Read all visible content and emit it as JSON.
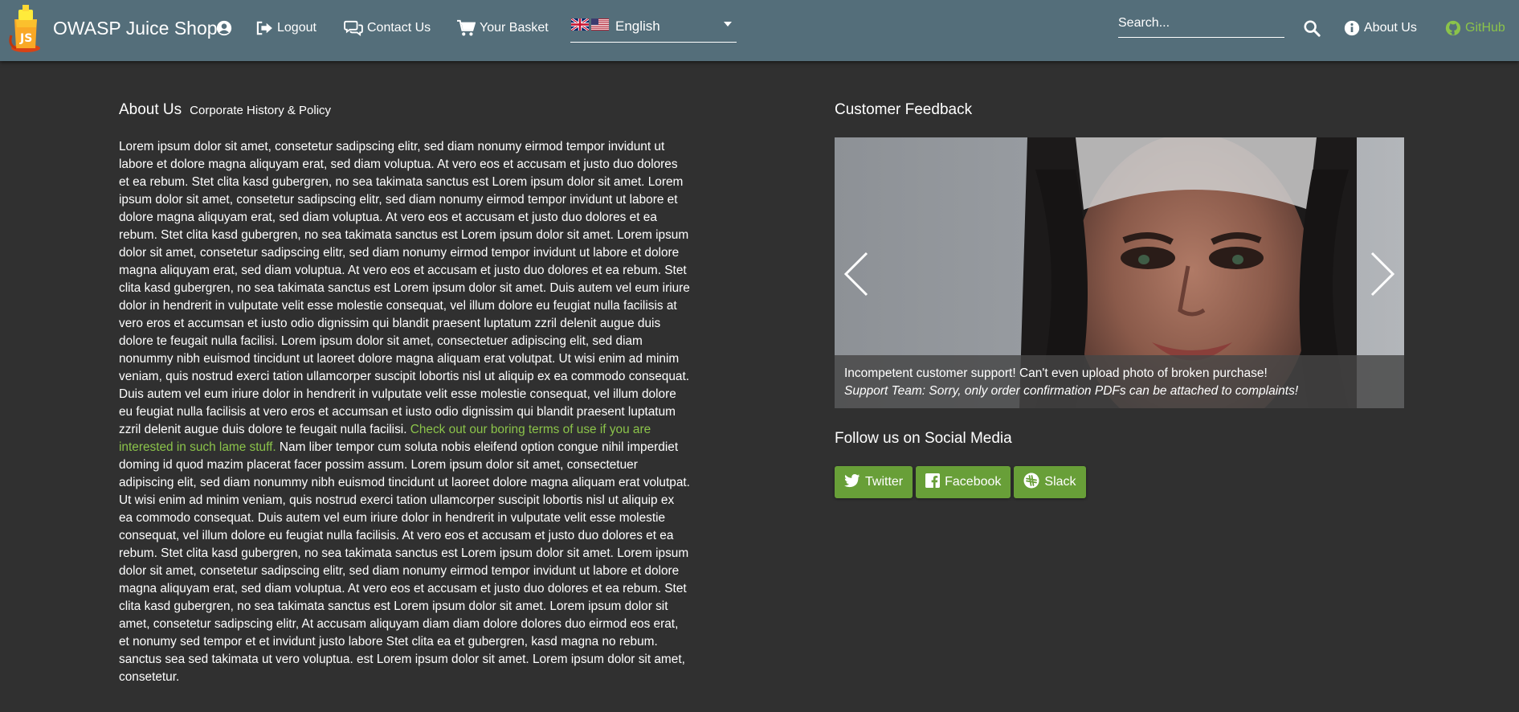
{
  "colors": {
    "navbar": "#546e7a",
    "background": "#303030",
    "accent_green": "#8bc34a",
    "button_green": "#689f38"
  },
  "navbar": {
    "brand": {
      "title": "OWASP Juice Shop",
      "icon": "juice-shop-logo"
    },
    "account": {
      "icon": "account-circle-icon"
    },
    "logout": {
      "label": "Logout",
      "icon": "sign-out-icon"
    },
    "contact": {
      "label": "Contact Us",
      "icon": "comments-icon"
    },
    "basket": {
      "label": "Your Basket",
      "icon": "cart-icon"
    },
    "language": {
      "selected": "English",
      "icons": [
        "uk-flag-icon",
        "us-flag-icon"
      ]
    },
    "search": {
      "placeholder": "Search..."
    },
    "about": {
      "label": "About Us",
      "icon": "info-circle-icon"
    },
    "github": {
      "label": "GitHub",
      "icon": "github-icon"
    }
  },
  "about": {
    "title": "About Us",
    "subtitle": "Corporate History & Policy",
    "text_before_link": "Lorem ipsum dolor sit amet, consetetur sadipscing elitr, sed diam nonumy eirmod tempor invidunt ut labore et dolore magna aliquyam erat, sed diam voluptua. At vero eos et accusam et justo duo dolores et ea rebum. Stet clita kasd gubergren, no sea takimata sanctus est Lorem ipsum dolor sit amet. Lorem ipsum dolor sit amet, consetetur sadipscing elitr, sed diam nonumy eirmod tempor invidunt ut labore et dolore magna aliquyam erat, sed diam voluptua. At vero eos et accusam et justo duo dolores et ea rebum. Stet clita kasd gubergren, no sea takimata sanctus est Lorem ipsum dolor sit amet. Lorem ipsum dolor sit amet, consetetur sadipscing elitr, sed diam nonumy eirmod tempor invidunt ut labore et dolore magna aliquyam erat, sed diam voluptua. At vero eos et accusam et justo duo dolores et ea rebum. Stet clita kasd gubergren, no sea takimata sanctus est Lorem ipsum dolor sit amet. Duis autem vel eum iriure dolor in hendrerit in vulputate velit esse molestie consequat, vel illum dolore eu feugiat nulla facilisis at vero eros et accumsan et iusto odio dignissim qui blandit praesent luptatum zzril delenit augue duis dolore te feugait nulla facilisi. Lorem ipsum dolor sit amet, consectetuer adipiscing elit, sed diam nonummy nibh euismod tincidunt ut laoreet dolore magna aliquam erat volutpat. Ut wisi enim ad minim veniam, quis nostrud exerci tation ullamcorper suscipit lobortis nisl ut aliquip ex ea commodo consequat. Duis autem vel eum iriure dolor in hendrerit in vulputate velit esse molestie consequat, vel illum dolore eu feugiat nulla facilisis at vero eros et accumsan et iusto odio dignissim qui blandit praesent luptatum zzril delenit augue duis dolore te feugait nulla facilisi. ",
    "link_text": "Check out our boring terms of use if you are interested in such lame stuff.",
    "text_after_link": " Nam liber tempor cum soluta nobis eleifend option congue nihil imperdiet doming id quod mazim placerat facer possim assum. Lorem ipsum dolor sit amet, consectetuer adipiscing elit, sed diam nonummy nibh euismod tincidunt ut laoreet dolore magna aliquam erat volutpat. Ut wisi enim ad minim veniam, quis nostrud exerci tation ullamcorper suscipit lobortis nisl ut aliquip ex ea commodo consequat. Duis autem vel eum iriure dolor in hendrerit in vulputate velit esse molestie consequat, vel illum dolore eu feugiat nulla facilisis. At vero eos et accusam et justo duo dolores et ea rebum. Stet clita kasd gubergren, no sea takimata sanctus est Lorem ipsum dolor sit amet. Lorem ipsum dolor sit amet, consetetur sadipscing elitr, sed diam nonumy eirmod tempor invidunt ut labore et dolore magna aliquyam erat, sed diam voluptua. At vero eos et accusam et justo duo dolores et ea rebum. Stet clita kasd gubergren, no sea takimata sanctus est Lorem ipsum dolor sit amet. Lorem ipsum dolor sit amet, consetetur sadipscing elitr, At accusam aliquyam diam diam dolore dolores duo eirmod eos erat, et nonumy sed tempor et et invidunt justo labore Stet clita ea et gubergren, kasd magna no rebum. sanctus sea sed takimata ut vero voluptua. est Lorem ipsum dolor sit amet. Lorem ipsum dolor sit amet, consetetur."
  },
  "feedback": {
    "title": "Customer Feedback",
    "caption_comment": "Incompetent customer support! Can't even upload photo of broken purchase!",
    "caption_reply": "Support Team: Sorry, only order confirmation PDFs can be attached to complaints!",
    "prev_icon": "chevron-left-icon",
    "next_icon": "chevron-right-icon"
  },
  "social": {
    "title": "Follow us on Social Media",
    "buttons": [
      {
        "label": "Twitter",
        "icon": "twitter-icon"
      },
      {
        "label": "Facebook",
        "icon": "facebook-icon"
      },
      {
        "label": "Slack",
        "icon": "slack-icon"
      }
    ]
  }
}
